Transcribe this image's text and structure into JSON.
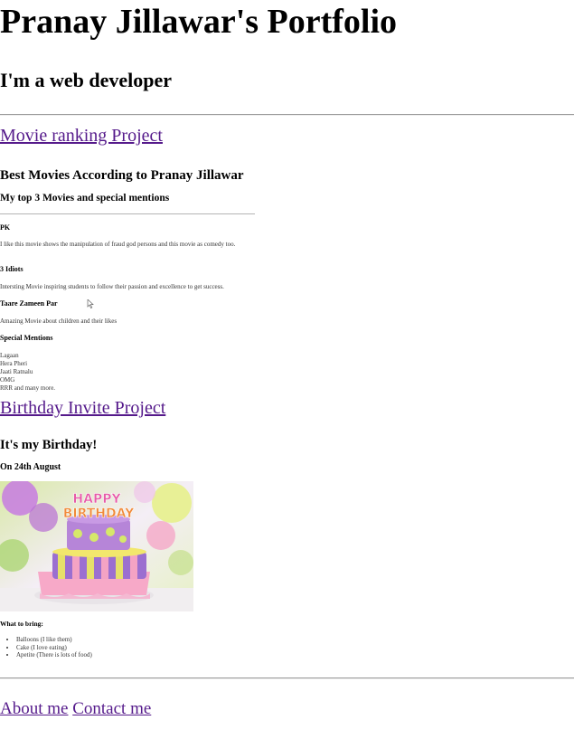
{
  "header": {
    "title": "Pranay Jillawar's Portfolio",
    "subtitle": "I'm a web developer"
  },
  "projects": {
    "movie_link": "Movie ranking Project",
    "birthday_link": "Birthday Invite Project"
  },
  "movies": {
    "title": "Best Movies According to Pranay Jillawar",
    "subtitle": "My top 3 Movies and special mentions",
    "items": [
      {
        "name": "PK",
        "description": "I like this movie shows the manipulation of fraud god persons and this movie as comedy too."
      },
      {
        "name": "3 Idiots",
        "description": "Intersting Movie inspiring students to follow their passion and excellence to get success."
      },
      {
        "name": "Taare Zameen Par",
        "description": "Amazing Movie about children and their likes"
      }
    ],
    "special_heading": "Special Mentions",
    "special": [
      "Lagaan",
      "Hera Pheri",
      "Jaati Ratnalu",
      "OMG",
      "RRR and many more."
    ]
  },
  "birthday": {
    "title": "It's my Birthday!",
    "date": "On 24th August",
    "cake_text": "HAPPY BIRTHDAY",
    "bring_heading": "What to bring:",
    "bring_items": [
      "Balloons (I like them)",
      "Cake (I love eating)",
      "Apetite (There is lots of food)"
    ]
  },
  "footer": {
    "about": "About me",
    "contact": "Contact me"
  },
  "colors": {
    "link": "#551a8b",
    "rule": "#9a9a9a"
  }
}
